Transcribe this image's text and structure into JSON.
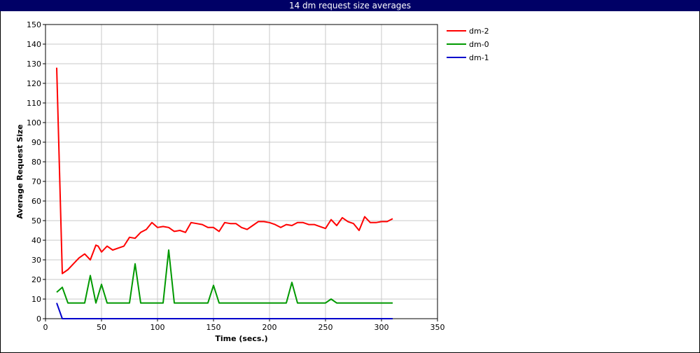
{
  "chart_data": {
    "type": "line",
    "title": "14 dm request size averages",
    "xlabel": "Time (secs.)",
    "ylabel": "Average Request Size",
    "xlim": [
      0,
      350
    ],
    "ylim": [
      0,
      150
    ],
    "xticks": [
      0,
      50,
      100,
      150,
      200,
      250,
      300,
      350
    ],
    "yticks": [
      0,
      10,
      20,
      30,
      40,
      50,
      60,
      70,
      80,
      90,
      100,
      110,
      120,
      130,
      140,
      150
    ],
    "grid": true,
    "legend_position": "right",
    "series": [
      {
        "name": "dm-2",
        "color": "#ff0000",
        "x": [
          10,
          15,
          20,
          25,
          30,
          35,
          40,
          45,
          47,
          50,
          55,
          60,
          65,
          70,
          75,
          80,
          85,
          90,
          95,
          100,
          105,
          110,
          115,
          120,
          125,
          130,
          135,
          140,
          145,
          150,
          155,
          160,
          165,
          170,
          175,
          180,
          185,
          190,
          195,
          200,
          205,
          210,
          215,
          220,
          225,
          230,
          235,
          240,
          245,
          250,
          255,
          260,
          265,
          270,
          275,
          280,
          285,
          290,
          295,
          300,
          305,
          310
        ],
        "y": [
          128,
          23,
          25,
          28,
          31,
          33,
          30,
          37.5,
          37,
          34,
          37,
          35,
          36,
          37,
          41.5,
          41,
          44,
          45.5,
          49,
          46.5,
          47,
          46.5,
          44.5,
          45,
          44,
          49,
          48.5,
          48,
          46.5,
          46.5,
          44.5,
          49,
          48.5,
          48.5,
          46.5,
          45.5,
          47.5,
          49.5,
          49.5,
          49,
          48,
          46.5,
          48,
          47.5,
          49,
          49,
          48,
          48,
          47,
          46,
          50.5,
          47.5,
          51.5,
          49.5,
          48.5,
          45,
          52,
          49,
          49,
          49.5,
          49.5,
          51
        ]
      },
      {
        "name": "dm-0",
        "color": "#009900",
        "x": [
          10,
          15,
          20,
          25,
          30,
          35,
          40,
          45,
          50,
          55,
          60,
          65,
          70,
          75,
          80,
          85,
          90,
          95,
          100,
          105,
          110,
          115,
          120,
          125,
          130,
          135,
          140,
          145,
          150,
          155,
          160,
          165,
          170,
          175,
          180,
          185,
          190,
          195,
          200,
          205,
          210,
          215,
          220,
          225,
          230,
          235,
          240,
          245,
          250,
          255,
          260,
          265,
          270,
          275,
          280,
          285,
          290,
          295,
          300,
          305,
          310
        ],
        "y": [
          13.5,
          16,
          8,
          8,
          8,
          8,
          22,
          8,
          17.5,
          8,
          8,
          8,
          8,
          8,
          28,
          8,
          8,
          8,
          8,
          8,
          35,
          8,
          8,
          8,
          8,
          8,
          8,
          8,
          17,
          8,
          8,
          8,
          8,
          8,
          8,
          8,
          8,
          8,
          8,
          8,
          8,
          8,
          18.5,
          8,
          8,
          8,
          8,
          8,
          8,
          10,
          8,
          8,
          8,
          8,
          8,
          8,
          8,
          8,
          8,
          8,
          8
        ]
      },
      {
        "name": "dm-1",
        "color": "#0000cc",
        "x": [
          10,
          15,
          20,
          50,
          100,
          150,
          200,
          250,
          300,
          310
        ],
        "y": [
          8,
          0,
          0,
          0,
          0,
          0,
          0,
          0,
          0,
          0
        ]
      }
    ]
  }
}
